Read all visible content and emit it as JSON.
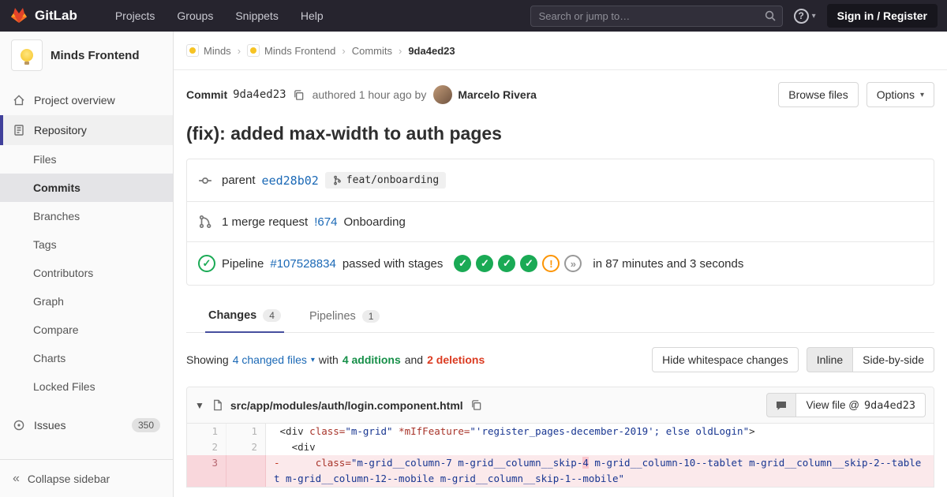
{
  "colors": {
    "accent_link": "#1b69b6",
    "success": "#1aaa55",
    "warning": "#fc9403",
    "danger": "#db3b21",
    "active_indicator": "#41419b",
    "navbar_bg": "#26242e"
  },
  "navbar": {
    "brand": "GitLab",
    "menu": [
      "Projects",
      "Groups",
      "Snippets",
      "Help"
    ],
    "search_placeholder": "Search or jump to…",
    "sign_in_label": "Sign in / Register"
  },
  "sidebar": {
    "project_name": "Minds Frontend",
    "project_overview_label": "Project overview",
    "repository_label": "Repository",
    "repo_items": [
      "Files",
      "Commits",
      "Branches",
      "Tags",
      "Contributors",
      "Graph",
      "Compare",
      "Charts",
      "Locked Files"
    ],
    "active_repo_item": "Commits",
    "issues_label": "Issues",
    "issues_count": "350",
    "collapse_label": "Collapse sidebar"
  },
  "breadcrumb": {
    "separator": "›",
    "items": [
      {
        "label": "Minds",
        "avatar": true,
        "current": false
      },
      {
        "label": "Minds Frontend",
        "avatar": true,
        "current": false
      },
      {
        "label": "Commits",
        "avatar": false,
        "current": false
      },
      {
        "label": "9da4ed23",
        "avatar": false,
        "current": true
      }
    ]
  },
  "commit": {
    "label": "Commit",
    "sha": "9da4ed23",
    "authored_text": "authored 1 hour ago by",
    "author_name": "Marcelo Rivera",
    "browse_files_label": "Browse files",
    "options_label": "Options",
    "title": "(fix): added max-width to auth pages",
    "parent": {
      "label": "parent",
      "sha": "eed28b02",
      "branch": "feat/onboarding"
    },
    "merge_request": {
      "count_text": "1 merge request",
      "id": "!674",
      "name": "Onboarding"
    },
    "pipeline": {
      "label": "Pipeline",
      "id": "#107528834",
      "status_text": "passed with stages",
      "stages": [
        "passed",
        "passed",
        "passed",
        "passed",
        "warning",
        "skipped"
      ],
      "duration_text": "in 87 minutes and 3 seconds"
    }
  },
  "tabs": [
    {
      "label": "Changes",
      "count": "4",
      "active": true
    },
    {
      "label": "Pipelines",
      "count": "1",
      "active": false
    }
  ],
  "diff_controls": {
    "showing": "Showing",
    "changed_files": "4 changed files",
    "with_text": "with",
    "additions": "4 additions",
    "and_text": "and",
    "deletions": "2 deletions",
    "hide_whitespace_label": "Hide whitespace changes",
    "inline_label": "Inline",
    "side_by_side_label": "Side-by-side"
  },
  "file_diff": {
    "path": "src/app/modules/auth/login.component.html",
    "view_file_label": "View file @",
    "view_file_sha": "9da4ed23",
    "rows": [
      {
        "old": "1",
        "new": "1",
        "type": "context",
        "marker": " ",
        "segments": [
          {
            "text": "<div ",
            "cls": "t"
          },
          {
            "text": "class=",
            "cls": "a"
          },
          {
            "text": "\"m-grid\"",
            "cls": "s"
          },
          {
            "text": " ",
            "cls": "t"
          },
          {
            "text": "*mIfFeature=",
            "cls": "a"
          },
          {
            "text": "\"'register_pages-december-2019'; else oldLogin\"",
            "cls": "s"
          },
          {
            "text": ">",
            "cls": "t"
          }
        ]
      },
      {
        "old": "2",
        "new": "2",
        "type": "context",
        "marker": " ",
        "segments": [
          {
            "text": "  <div",
            "cls": "t"
          }
        ]
      },
      {
        "old": "3",
        "new": "",
        "type": "del",
        "marker": "-",
        "segments": [
          {
            "text": "      ",
            "cls": "t"
          },
          {
            "text": "class=",
            "cls": "a"
          },
          {
            "text": "\"m-grid__column-7 m-grid__column__skip-",
            "cls": "s"
          },
          {
            "text": "4",
            "cls": "s",
            "hl": true
          },
          {
            "text": " m-grid__column-10--tablet m-grid__column__skip-2--tablet m-grid__column-12--mobile m-grid__column__skip-1--mobile\"",
            "cls": "s"
          }
        ]
      }
    ]
  }
}
